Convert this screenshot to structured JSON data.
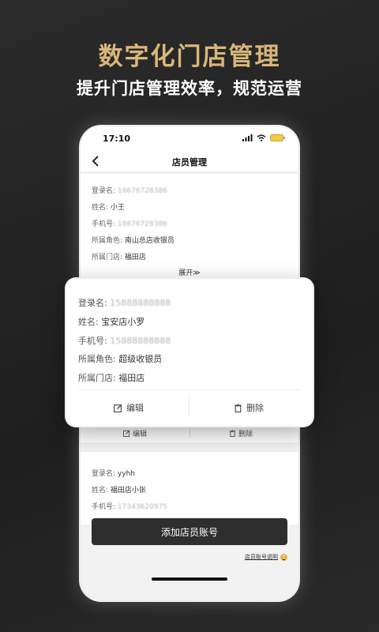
{
  "banner": {
    "title": "数字化门店管理",
    "subtitle": "提升门店管理效率，规范运营"
  },
  "status_bar": {
    "time": "17:10"
  },
  "nav": {
    "title": "店员管理"
  },
  "card1": {
    "login_label": "登录名:",
    "login_value": "18676728386",
    "name_label": "姓名:",
    "name_value": "小王",
    "phone_label": "手机号:",
    "phone_value": "18676728386",
    "role_label": "所属角色:",
    "role_value": "南山总店收银员",
    "store_label": "所属门店:",
    "store_value": "福田店",
    "expand_label": "展开≫"
  },
  "behind_actions": {
    "edit_label": "编辑",
    "delete_label": "删除"
  },
  "floating_card": {
    "login_label": "登录名:",
    "login_value": "15888888888",
    "name_label": "姓名:",
    "name_value": "宝安店小罗",
    "phone_label": "手机号:",
    "phone_value": "15888888888",
    "role_label": "所属角色:",
    "role_value": "超级收银员",
    "store_label": "所属门店:",
    "store_value": "福田店",
    "edit_label": "编辑",
    "delete_label": "删除"
  },
  "card2": {
    "login_label": "登录名:",
    "login_value": "yyhh",
    "name_label": "姓名:",
    "name_value": "福田店小张",
    "phone_label": "手机号:",
    "phone_value": "17343620975"
  },
  "add_button": "添加店员账号",
  "help_link": "店员账号说明",
  "colors": {
    "gold": "#d9b77a",
    "dark": "#2e2e2e",
    "help_badge": "#e3b340"
  },
  "icons": [
    "back-chevron-icon",
    "signal-icon",
    "wifi-icon",
    "battery-icon",
    "edit-icon",
    "trash-icon",
    "question-icon"
  ]
}
